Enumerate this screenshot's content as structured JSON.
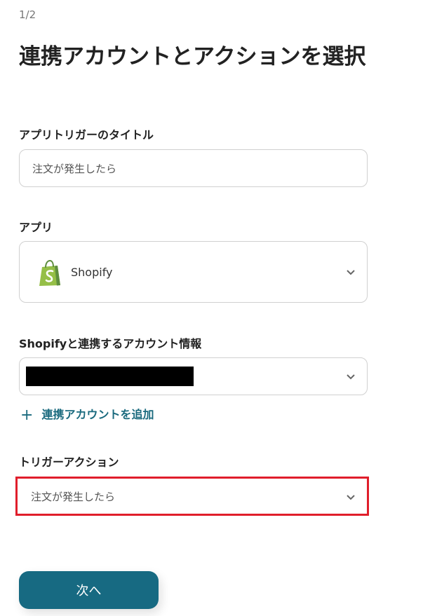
{
  "header": {
    "step": "1/2",
    "title": "連携アカウントとアクションを選択"
  },
  "trigger_title": {
    "label": "アプリトリガーのタイトル",
    "value": "注文が発生したら"
  },
  "app": {
    "label": "アプリ",
    "selected": "Shopify",
    "logo_icon": "shopify-bag-icon",
    "logo_color": "#95bf47"
  },
  "account": {
    "label": "Shopifyと連携するアカウント情報",
    "add_link": "連携アカウントを追加",
    "add_icon": "plus-icon"
  },
  "trigger_action": {
    "label": "トリガーアクション",
    "selected": "注文が発生したら",
    "highlight_color": "#e01e2b"
  },
  "footer": {
    "next_label": "次へ",
    "button_color": "#176a82"
  }
}
